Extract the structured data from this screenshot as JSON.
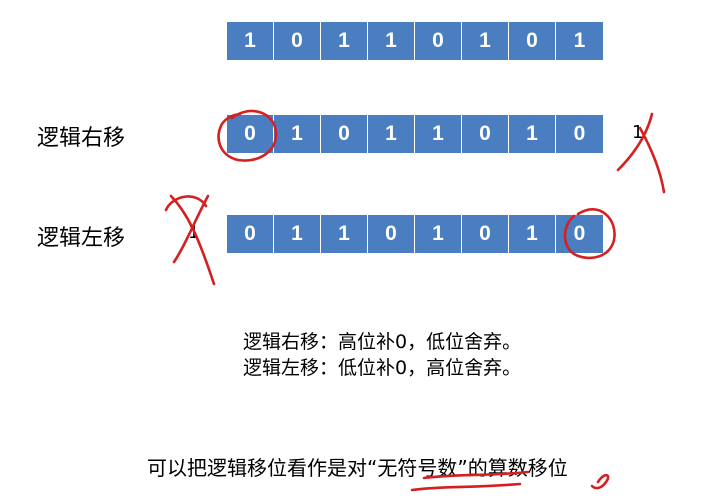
{
  "rows": {
    "original": {
      "bits": [
        "1",
        "0",
        "1",
        "1",
        "0",
        "1",
        "0",
        "1"
      ]
    },
    "logical_right": {
      "label": "逻辑右移",
      "bits": [
        "0",
        "1",
        "0",
        "1",
        "1",
        "0",
        "1",
        "0"
      ],
      "dropped_bit": "1"
    },
    "logical_left": {
      "label": "逻辑左移",
      "bits": [
        "0",
        "1",
        "1",
        "0",
        "1",
        "0",
        "1",
        "0"
      ],
      "dropped_bit": "1"
    }
  },
  "notes": {
    "right_rule": "逻辑右移：高位补0，低位舍弃。",
    "left_rule": "逻辑左移：低位补0，高位舍弃。"
  },
  "summary": {
    "prefix": "可以把逻辑移位看作是对",
    "emphasis": "“无符号数”",
    "suffix": "的算数移位"
  },
  "colors": {
    "cell_fill": "#4a7ec0",
    "cell_text": "#ffffff",
    "annotation_ink": "#d42020"
  }
}
